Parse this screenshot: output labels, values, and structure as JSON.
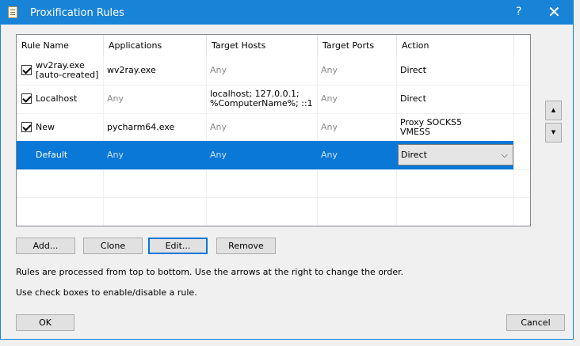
{
  "window": {
    "title": "Proxification Rules",
    "help_glyph": "?",
    "close_glyph": "✕"
  },
  "columns": [
    "Rule Name",
    "Applications",
    "Target Hosts",
    "Target Ports",
    "Action"
  ],
  "rules": [
    {
      "enabled": true,
      "name_lines": [
        "wv2ray.exe",
        "[auto-created]"
      ],
      "applications": "wv2ray.exe",
      "target_hosts_lines": [
        "Any"
      ],
      "target_ports": "Any",
      "action_lines": [
        "Direct"
      ]
    },
    {
      "enabled": true,
      "name_lines": [
        "Localhost"
      ],
      "applications": "Any",
      "target_hosts_lines": [
        "localhost; 127.0.0.1;",
        "%ComputerName%; ::1"
      ],
      "target_ports": "Any",
      "action_lines": [
        "Direct"
      ]
    },
    {
      "enabled": true,
      "name_lines": [
        "New"
      ],
      "applications": "pycharm64.exe",
      "target_hosts_lines": [
        "Any"
      ],
      "target_ports": "Any",
      "action_lines": [
        "Proxy SOCKS5",
        "VMESS"
      ]
    },
    {
      "enabled": null,
      "name_lines": [
        "Default"
      ],
      "applications": "Any",
      "target_hosts_lines": [
        "Any"
      ],
      "target_ports": "Any",
      "action_selected": "Direct"
    }
  ],
  "order_buttons": {
    "up": "▲",
    "down": "▼"
  },
  "buttons": {
    "add": "Add...",
    "clone": "Clone",
    "edit": "Edit...",
    "remove": "Remove",
    "ok": "OK",
    "cancel": "Cancel"
  },
  "info": {
    "line1": "Rules are processed from top to bottom. Use the arrows at the right to change the order.",
    "line2": "Use check boxes to enable/disable a rule."
  },
  "colors": {
    "title_bar": "#1883d7",
    "selected_row": "#0a78d7",
    "dialog_bg": "#f0f0f0"
  }
}
